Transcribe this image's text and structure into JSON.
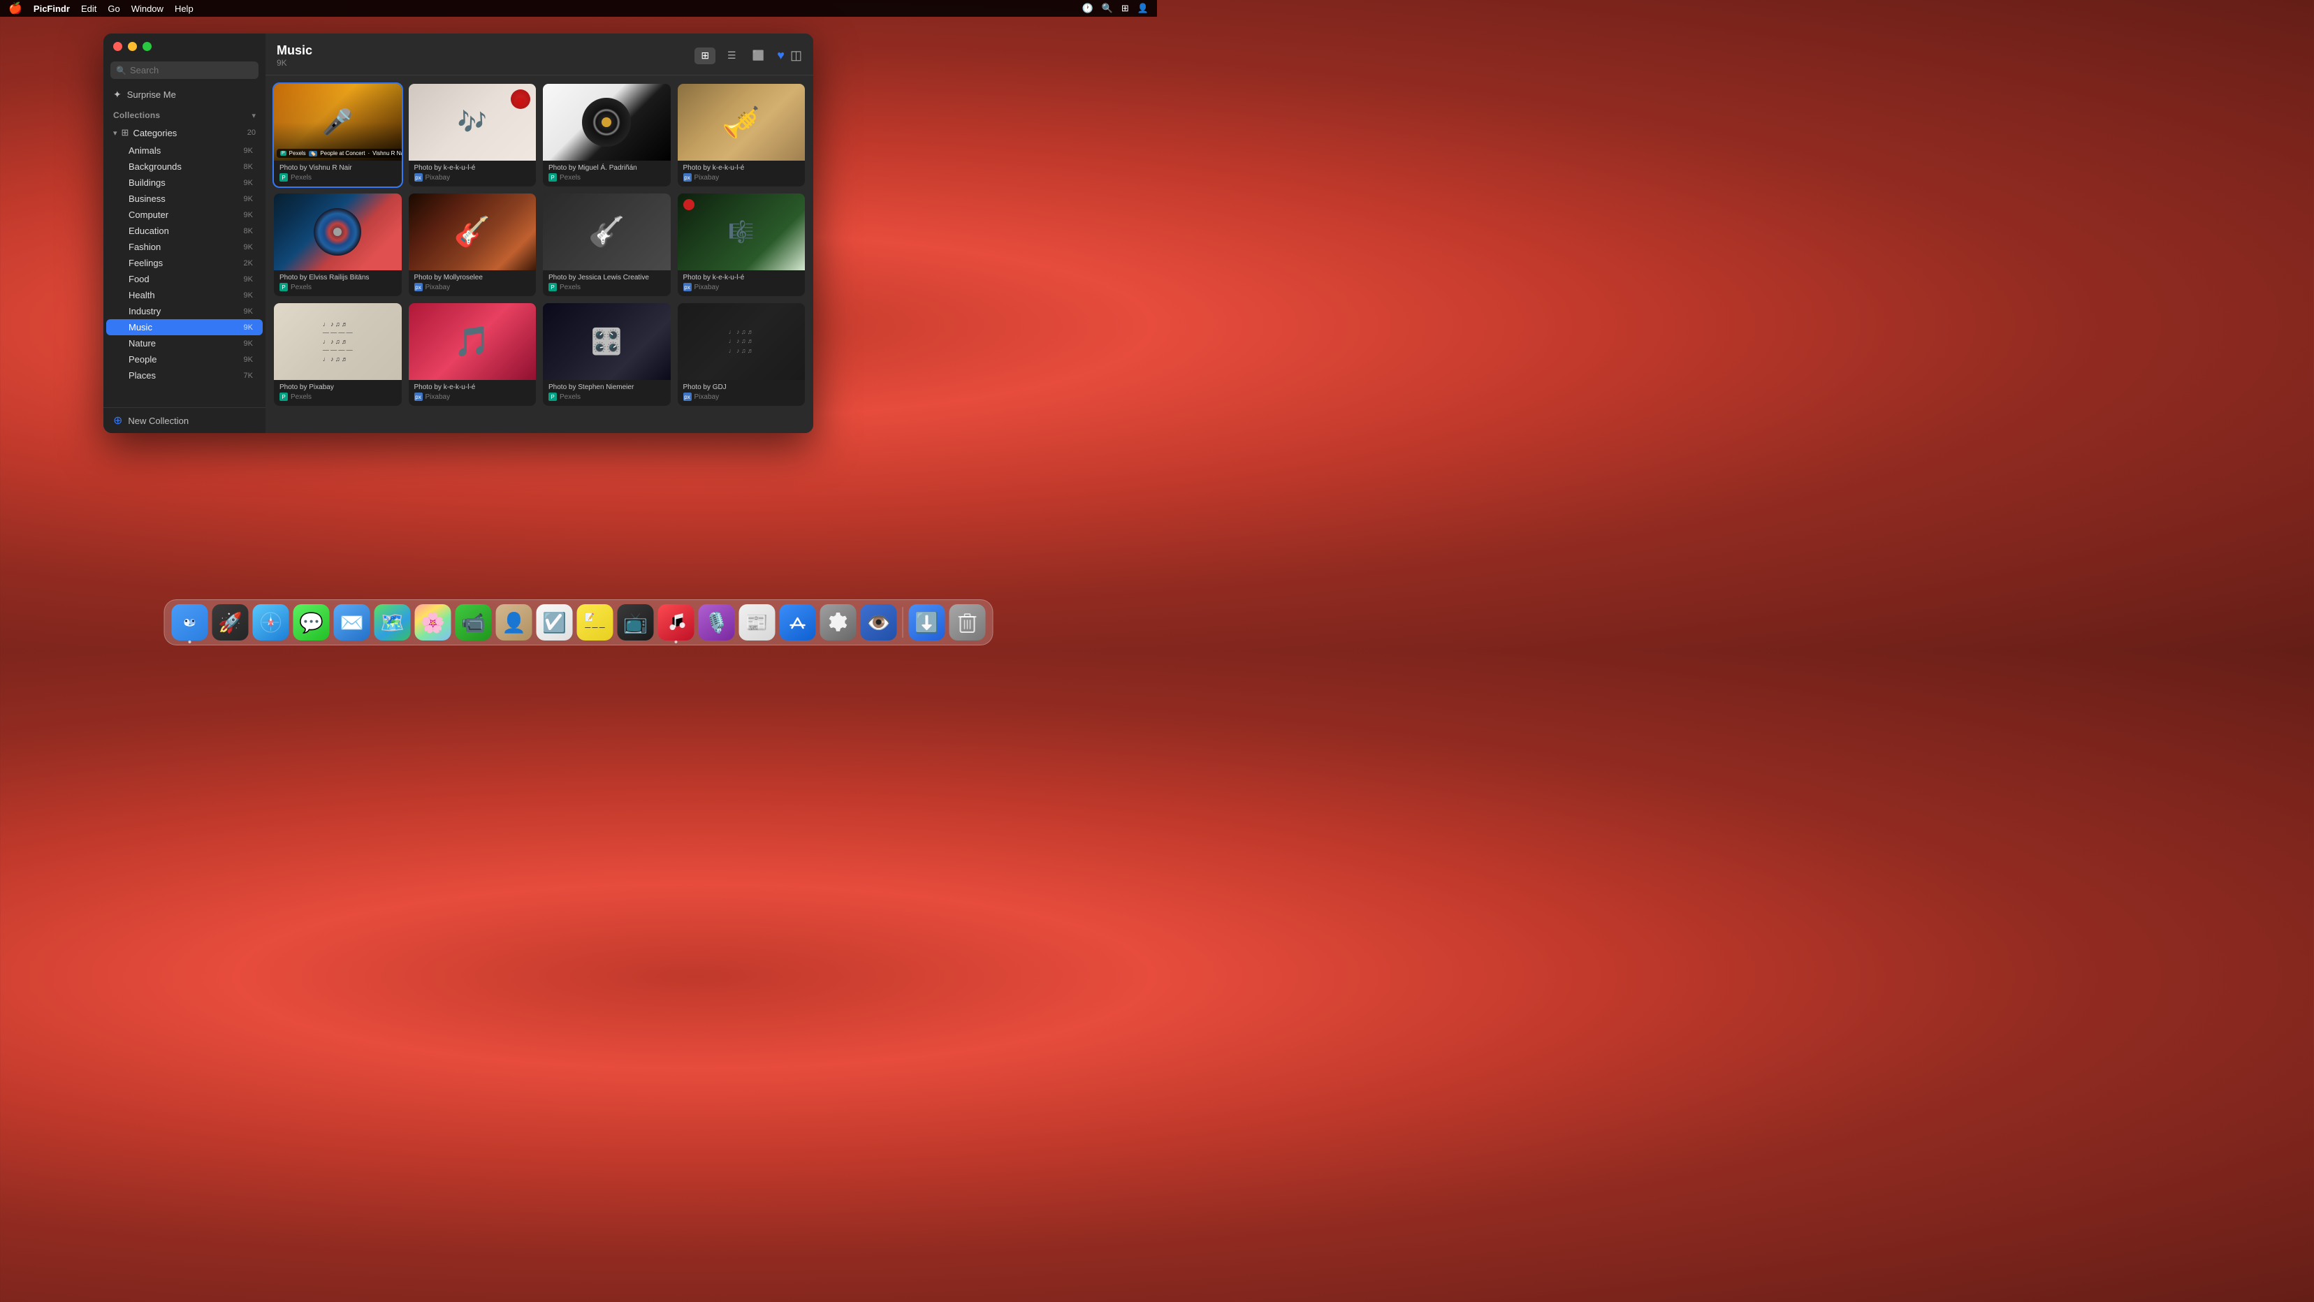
{
  "menubar": {
    "apple": "🍎",
    "app_name": "PicFindr",
    "items": [
      "Edit",
      "Go",
      "Window",
      "Help"
    ],
    "right_items": [
      "□□",
      "🔍",
      "⊞"
    ]
  },
  "window": {
    "title": "Music",
    "count": "9K",
    "view_modes": [
      "grid",
      "list",
      "preview"
    ],
    "search_placeholder": "Search"
  },
  "sidebar": {
    "search_placeholder": "Search",
    "surprise_me": "Surprise Me",
    "collections_label": "Collections",
    "categories_label": "Categories",
    "categories_count": "20",
    "new_collection": "New Collection",
    "items": [
      {
        "name": "Animals",
        "count": "9K"
      },
      {
        "name": "Backgrounds",
        "count": "8K"
      },
      {
        "name": "Buildings",
        "count": "9K"
      },
      {
        "name": "Business",
        "count": "9K"
      },
      {
        "name": "Computer",
        "count": "9K"
      },
      {
        "name": "Education",
        "count": "8K"
      },
      {
        "name": "Fashion",
        "count": "9K"
      },
      {
        "name": "Feelings",
        "count": "2K"
      },
      {
        "name": "Food",
        "count": "9K"
      },
      {
        "name": "Health",
        "count": "9K"
      },
      {
        "name": "Industry",
        "count": "9K"
      },
      {
        "name": "Music",
        "count": "9K",
        "active": true
      },
      {
        "name": "Nature",
        "count": "9K"
      },
      {
        "name": "People",
        "count": "9K"
      },
      {
        "name": "Places",
        "count": "7K"
      }
    ]
  },
  "photos": [
    {
      "id": 1,
      "credit": "Photo by Vishnu R Nair",
      "source": "Pexels",
      "source_type": "pexels",
      "selected": true,
      "tooltip": "People at Concert · Vishnu R Nair",
      "thumb_type": "concert"
    },
    {
      "id": 2,
      "credit": "Photo by k-e-k-u-l-é",
      "source": "Pixabay",
      "source_type": "pixabay",
      "selected": false,
      "thumb_type": "music-sheet"
    },
    {
      "id": 3,
      "credit": "Photo by Miguel Á. Padriñán",
      "source": "Pexels",
      "source_type": "pexels",
      "selected": false,
      "thumb_type": "vinyl"
    },
    {
      "id": 4,
      "credit": "Photo by k-e-k-u-l-é",
      "source": "Pixabay",
      "source_type": "pixabay",
      "selected": false,
      "thumb_type": "horn"
    },
    {
      "id": 5,
      "credit": "Photo by Elviss Railijs Bitāns",
      "source": "Pexels",
      "source_type": "pexels",
      "selected": false,
      "thumb_type": "vinyl-blue"
    },
    {
      "id": 6,
      "credit": "Photo by Mollyroselee",
      "source": "Pixabay",
      "source_type": "pixabay",
      "selected": false,
      "thumb_type": "guitar"
    },
    {
      "id": 7,
      "credit": "Photo by Jessica Lewis Creative",
      "source": "Pexels",
      "source_type": "pexels",
      "selected": false,
      "thumb_type": "guitar-bw"
    },
    {
      "id": 8,
      "credit": "Photo by k-e-k-u-l-é",
      "source": "Pixabay",
      "source_type": "pixabay",
      "selected": false,
      "thumb_type": "sheet-xmas"
    },
    {
      "id": 9,
      "credit": "Photo by Pixabay",
      "source": "Pexels",
      "source_type": "pexels",
      "selected": false,
      "thumb_type": "music-notes"
    },
    {
      "id": 10,
      "credit": "Photo by k-e-k-u-l-é",
      "source": "Pixabay",
      "source_type": "pixabay",
      "selected": false,
      "thumb_type": "pink-music"
    },
    {
      "id": 11,
      "credit": "Photo by Stephen Niemeier",
      "source": "Pexels",
      "source_type": "pexels",
      "selected": false,
      "thumb_type": "dj"
    },
    {
      "id": 12,
      "credit": "Photo by GDJ",
      "source": "Pixabay",
      "source_type": "pixabay",
      "selected": false,
      "thumb_type": "sheet-dark"
    }
  ],
  "dock": {
    "items": [
      {
        "name": "Finder",
        "icon": "🔵",
        "has_dot": true,
        "type": "finder"
      },
      {
        "name": "Launchpad",
        "icon": "🚀",
        "has_dot": false,
        "type": "launchpad"
      },
      {
        "name": "Safari",
        "icon": "🧭",
        "has_dot": false,
        "type": "safari"
      },
      {
        "name": "Messages",
        "icon": "💬",
        "has_dot": false,
        "type": "messages"
      },
      {
        "name": "Mail",
        "icon": "✉️",
        "has_dot": false,
        "type": "mail"
      },
      {
        "name": "Maps",
        "icon": "🗺️",
        "has_dot": false,
        "type": "maps"
      },
      {
        "name": "Photos",
        "icon": "🌸",
        "has_dot": false,
        "type": "photos"
      },
      {
        "name": "FaceTime",
        "icon": "📹",
        "has_dot": false,
        "type": "facetime"
      },
      {
        "name": "Contacts",
        "icon": "👤",
        "has_dot": false,
        "type": "contacts"
      },
      {
        "name": "Reminders",
        "icon": "☑️",
        "has_dot": false,
        "type": "reminders"
      },
      {
        "name": "Notes",
        "icon": "📝",
        "has_dot": false,
        "type": "notes"
      },
      {
        "name": "TV",
        "icon": "📺",
        "has_dot": false,
        "type": "tv"
      },
      {
        "name": "Music",
        "icon": "🎵",
        "has_dot": true,
        "type": "music"
      },
      {
        "name": "Podcasts",
        "icon": "🎙️",
        "has_dot": false,
        "type": "podcasts"
      },
      {
        "name": "News",
        "icon": "📰",
        "has_dot": false,
        "type": "news"
      },
      {
        "name": "App Store",
        "icon": "🅰️",
        "has_dot": false,
        "type": "appstore"
      },
      {
        "name": "System Preferences",
        "icon": "⚙️",
        "has_dot": false,
        "type": "settings"
      },
      {
        "name": "Proxyman",
        "icon": "👁️",
        "has_dot": false,
        "type": "eye"
      },
      {
        "name": "Downloads",
        "icon": "⬇️",
        "has_dot": false,
        "type": "downloads"
      },
      {
        "name": "Trash",
        "icon": "🗑️",
        "has_dot": false,
        "type": "trash"
      }
    ]
  }
}
